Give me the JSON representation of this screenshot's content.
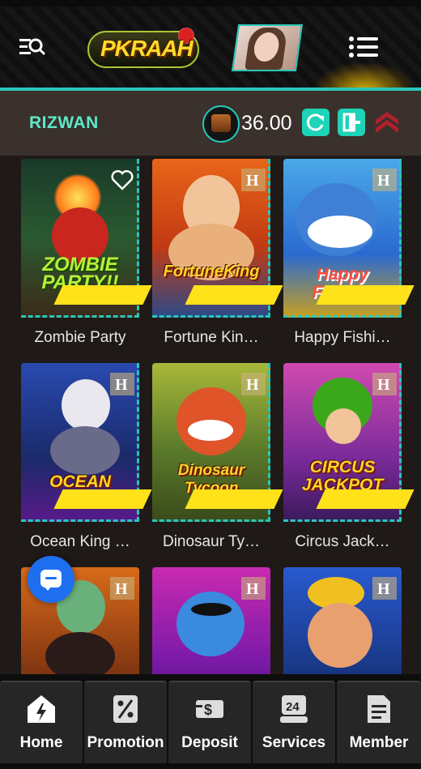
{
  "header": {
    "logo_text": "PKRAAH",
    "search_icon": "search-menu-icon",
    "menu_icon": "list-menu-icon"
  },
  "user": {
    "name": "RIZWAN",
    "balance": "36.00",
    "refresh_icon": "refresh-icon",
    "logout_icon": "logout-icon",
    "rank_icon": "rank-chevron-icon"
  },
  "colors": {
    "accent": "#29c7b9",
    "username": "#5ee8c9",
    "button": "#1ed3b8",
    "ribbon": "#ffe21a",
    "chat": "#1e6ff0"
  },
  "games": [
    {
      "name": "Zombie Party",
      "art_text": "ZOMBIE PARTY!!"
    },
    {
      "name": "Fortune Kin…",
      "art_text": "FortuneKing"
    },
    {
      "name": "Happy Fishi…",
      "art_text": "Happy Fishing"
    },
    {
      "name": "Ocean King …",
      "art_text": "OCEAN KING"
    },
    {
      "name": "Dinosaur Ty…",
      "art_text": "Dinosaur Tycoon"
    },
    {
      "name": "Circus Jack…",
      "art_text": "CIRCUS JACKPOT"
    },
    {
      "name": "",
      "art_text": ""
    },
    {
      "name": "",
      "art_text": ""
    },
    {
      "name": "",
      "art_text": ""
    }
  ],
  "nav": [
    {
      "label": "Home",
      "icon": "home-icon"
    },
    {
      "label": "Promotion",
      "icon": "percent-tag-icon"
    },
    {
      "label": "Deposit",
      "icon": "cash-icon"
    },
    {
      "label": "Services",
      "icon": "support-24-icon"
    },
    {
      "label": "Member",
      "icon": "document-icon"
    }
  ]
}
